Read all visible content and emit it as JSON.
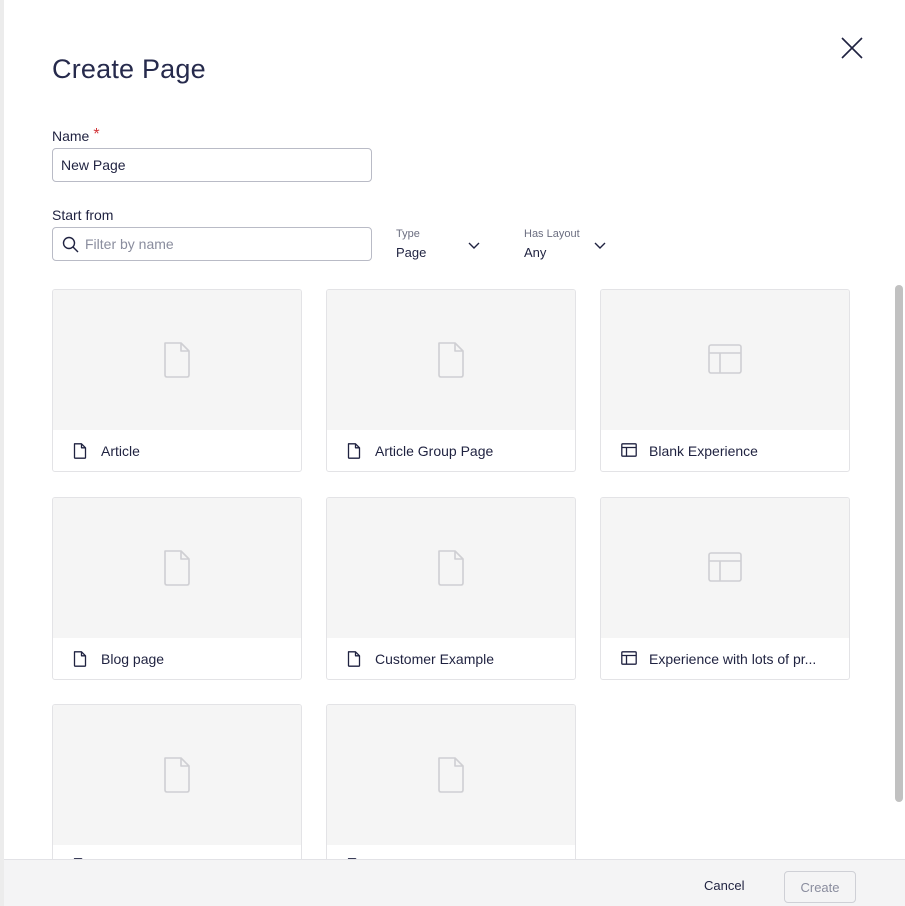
{
  "dialog": {
    "title": "Create Page",
    "close_icon": "close-icon"
  },
  "name_field": {
    "label": "Name",
    "required_marker": "*",
    "value": "New Page"
  },
  "start_from": {
    "label": "Start from",
    "search_placeholder": "Filter by name",
    "search_icon": "search-icon"
  },
  "filters": {
    "type": {
      "label": "Type",
      "value": "Page"
    },
    "has_layout": {
      "label": "Has Layout",
      "value": "Any"
    }
  },
  "templates": [
    {
      "label": "Article",
      "icon": "page-icon"
    },
    {
      "label": "Article Group Page",
      "icon": "page-icon"
    },
    {
      "label": "Blank Experience",
      "icon": "layout-icon"
    },
    {
      "label": "Blog page",
      "icon": "page-icon"
    },
    {
      "label": "Customer Example",
      "icon": "page-icon"
    },
    {
      "label": "Experience with lots of pr...",
      "icon": "layout-icon"
    },
    {
      "label": "",
      "icon": "page-icon"
    },
    {
      "label": "",
      "icon": "page-icon"
    }
  ],
  "footer": {
    "cancel_label": "Cancel",
    "create_label": "Create"
  },
  "colors": {
    "accent_text": "#1f2240",
    "required": "#d13438",
    "thumb_bg": "#f5f5f5"
  }
}
